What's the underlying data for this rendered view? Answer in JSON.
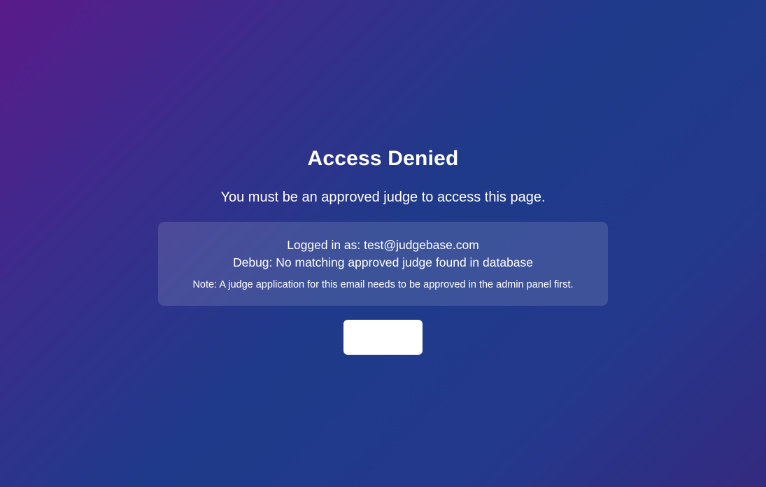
{
  "page": {
    "title": "Access Denied",
    "subtitle": "You must be an approved judge to access this page."
  },
  "info_box": {
    "logged_in_line": "Logged in as: test@judgebase.com",
    "debug_line": "Debug: No matching approved judge found in database",
    "note_line": "Note: A judge application for this email needs to be approved in the admin panel first."
  },
  "action": {
    "button_label": ""
  },
  "colors": {
    "gradient_start": "#5a1a8a",
    "gradient_mid": "#1f3a8a",
    "gradient_end": "#342a80",
    "text": "#ffffff",
    "button_bg": "#ffffff"
  }
}
